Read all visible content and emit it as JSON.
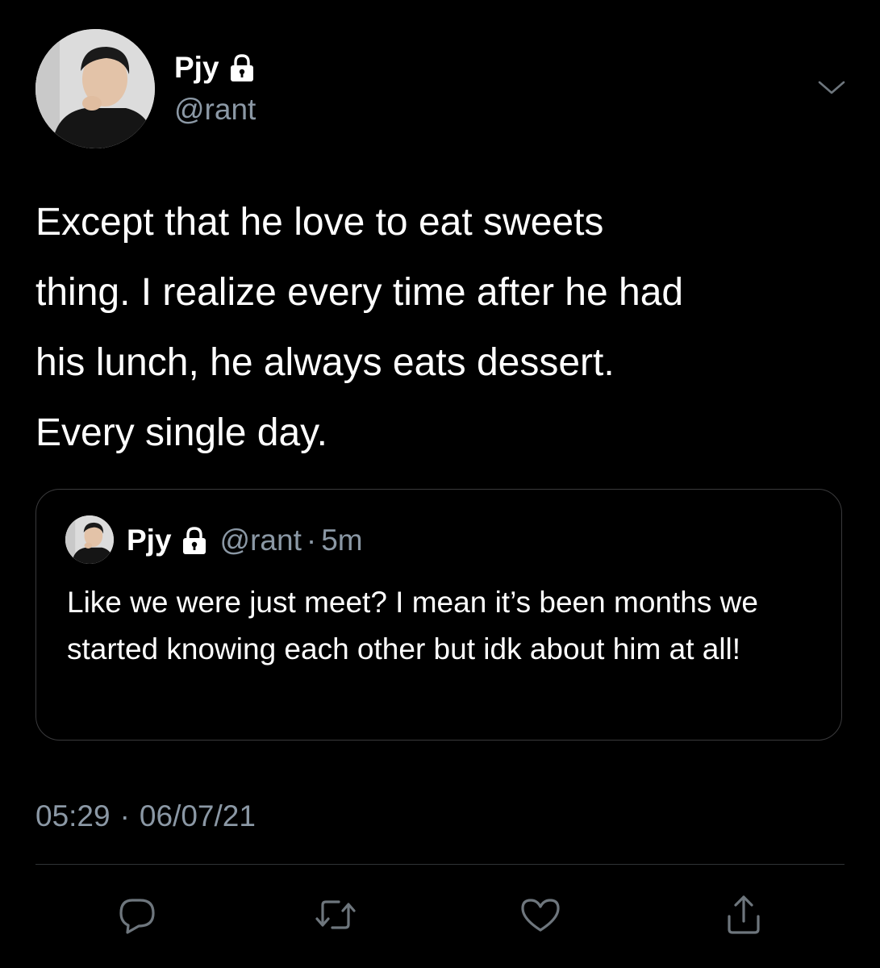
{
  "tweet": {
    "author": {
      "display_name": "Pjy",
      "handle": "@rant",
      "protected_icon": "lock-icon"
    },
    "text": "Except that he love to eat sweets\nthing. I realize every time after he had\nhis lunch, he always eats dessert.\nEvery single day.",
    "menu_icon": "chevron-down-icon",
    "time": "05:29",
    "date": "06/07/21",
    "separator": "·"
  },
  "quoted_tweet": {
    "display_name": "Pjy",
    "handle": "@rant",
    "separator": "·",
    "age": "5m",
    "text": "Like we were just meet? I mean it’s been months we started knowing each other but idk about him at all!"
  },
  "actions": [
    {
      "icon": "reply-icon"
    },
    {
      "icon": "retweet-icon"
    },
    {
      "icon": "like-icon"
    },
    {
      "icon": "share-icon"
    }
  ],
  "colors": {
    "background": "#000000",
    "primary_text": "#ffffff",
    "secondary_text": "#8b98a5",
    "border": "#3a3a3c",
    "divider": "#2f3336"
  }
}
